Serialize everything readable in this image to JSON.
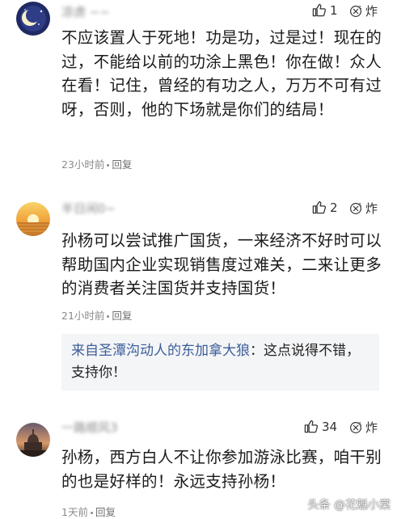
{
  "comments": [
    {
      "username": "凉虏 ~~",
      "likes": "1",
      "body": "不应该置人于死地！功是功，过是过！现在的过，不能给以前的功涂上黑色！你在做！众人在看！记住，曾经的有功之人，万万不可有过呀，否则，他的下场就是你们的结局！",
      "time": "23小时前",
      "reply_label": "回复"
    },
    {
      "username": "半日闲0~",
      "likes": "2",
      "body": "孙杨可以尝试推广国货，一来经济不好时可以帮助国内企业实现销售度过难关，二来让更多的消费者关注国货并支持国货！",
      "time": "21小时前",
      "reply_label": "回复",
      "reply": {
        "author": "来自圣潭沟动人的东加拿大狼",
        "text": "：这点说得不错，支持你！"
      }
    },
    {
      "username": "一路顺风3",
      "likes": "34",
      "body": "孙杨，西方白人不让你参加游泳比赛，咱干别的也是好样的！永远支持孙杨！",
      "time": "1天前",
      "reply_label": "回复"
    }
  ],
  "fire_label": "炸",
  "watermark": "头条 @花魁小棠",
  "colors": {
    "link": "#3b5f9a",
    "meta": "#8a8a8a",
    "reply_bg": "#f4f5f7"
  }
}
